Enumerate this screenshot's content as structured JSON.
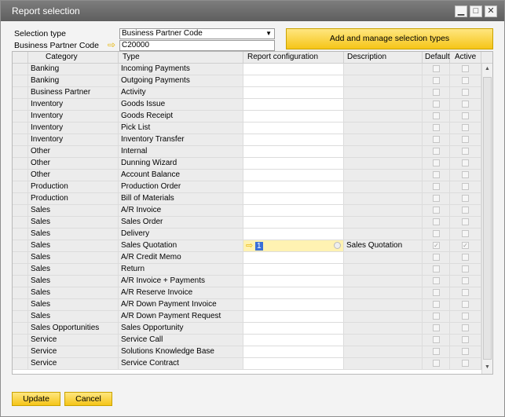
{
  "window": {
    "title": "Report selection"
  },
  "form": {
    "selection_type_label": "Selection type",
    "selection_type_value": "Business Partner Code",
    "bp_code_label": "Business Partner Code",
    "bp_code_value": "C20000",
    "add_manage_label": "Add and manage selection types"
  },
  "table": {
    "headers": [
      "",
      "Category",
      "Type",
      "Report configuration",
      "Description",
      "Default",
      "Active"
    ],
    "rows": [
      {
        "category": "Banking",
        "type": "Incoming Payments",
        "config": "",
        "description": ""
      },
      {
        "category": "Banking",
        "type": "Outgoing Payments",
        "config": "",
        "description": ""
      },
      {
        "category": "Business Partner",
        "type": "Activity",
        "config": "",
        "description": ""
      },
      {
        "category": "Inventory",
        "type": "Goods Issue",
        "config": "",
        "description": ""
      },
      {
        "category": "Inventory",
        "type": "Goods Receipt",
        "config": "",
        "description": ""
      },
      {
        "category": "Inventory",
        "type": "Pick List",
        "config": "",
        "description": ""
      },
      {
        "category": "Inventory",
        "type": "Inventory Transfer",
        "config": "",
        "description": ""
      },
      {
        "category": "Other",
        "type": "Internal",
        "config": "",
        "description": ""
      },
      {
        "category": "Other",
        "type": "Dunning Wizard",
        "config": "",
        "description": ""
      },
      {
        "category": "Other",
        "type": "Account Balance",
        "config": "",
        "description": ""
      },
      {
        "category": "Production",
        "type": "Production Order",
        "config": "",
        "description": ""
      },
      {
        "category": "Production",
        "type": "Bill of Materials",
        "config": "",
        "description": ""
      },
      {
        "category": "Sales",
        "type": "A/R Invoice",
        "config": "",
        "description": ""
      },
      {
        "category": "Sales",
        "type": "Sales Order",
        "config": "",
        "description": ""
      },
      {
        "category": "Sales",
        "type": "Delivery",
        "config": "",
        "description": ""
      },
      {
        "category": "Sales",
        "type": "Sales Quotation",
        "config": "1",
        "description": "Sales Quotation"
      },
      {
        "category": "Sales",
        "type": "A/R Credit Memo",
        "config": "",
        "description": ""
      },
      {
        "category": "Sales",
        "type": "Return",
        "config": "",
        "description": ""
      },
      {
        "category": "Sales",
        "type": "A/R Invoice + Payments",
        "config": "",
        "description": ""
      },
      {
        "category": "Sales",
        "type": "A/R Reserve Invoice",
        "config": "",
        "description": ""
      },
      {
        "category": "Sales",
        "type": "A/R Down Payment Invoice",
        "config": "",
        "description": ""
      },
      {
        "category": "Sales",
        "type": "A/R Down Payment Request",
        "config": "",
        "description": ""
      },
      {
        "category": "Sales Opportunities",
        "type": "Sales Opportunity",
        "config": "",
        "description": ""
      },
      {
        "category": "Service",
        "type": "Service Call",
        "config": "",
        "description": ""
      },
      {
        "category": "Service",
        "type": "Solutions Knowledge Base",
        "config": "",
        "description": ""
      },
      {
        "category": "Service",
        "type": "Service Contract",
        "config": "",
        "description": ""
      }
    ]
  },
  "selected_row_index": 15,
  "buttons": {
    "update": "Update",
    "cancel": "Cancel"
  },
  "colors": {
    "accent": "#f5c518",
    "titlebar": "#6b6b6b"
  }
}
